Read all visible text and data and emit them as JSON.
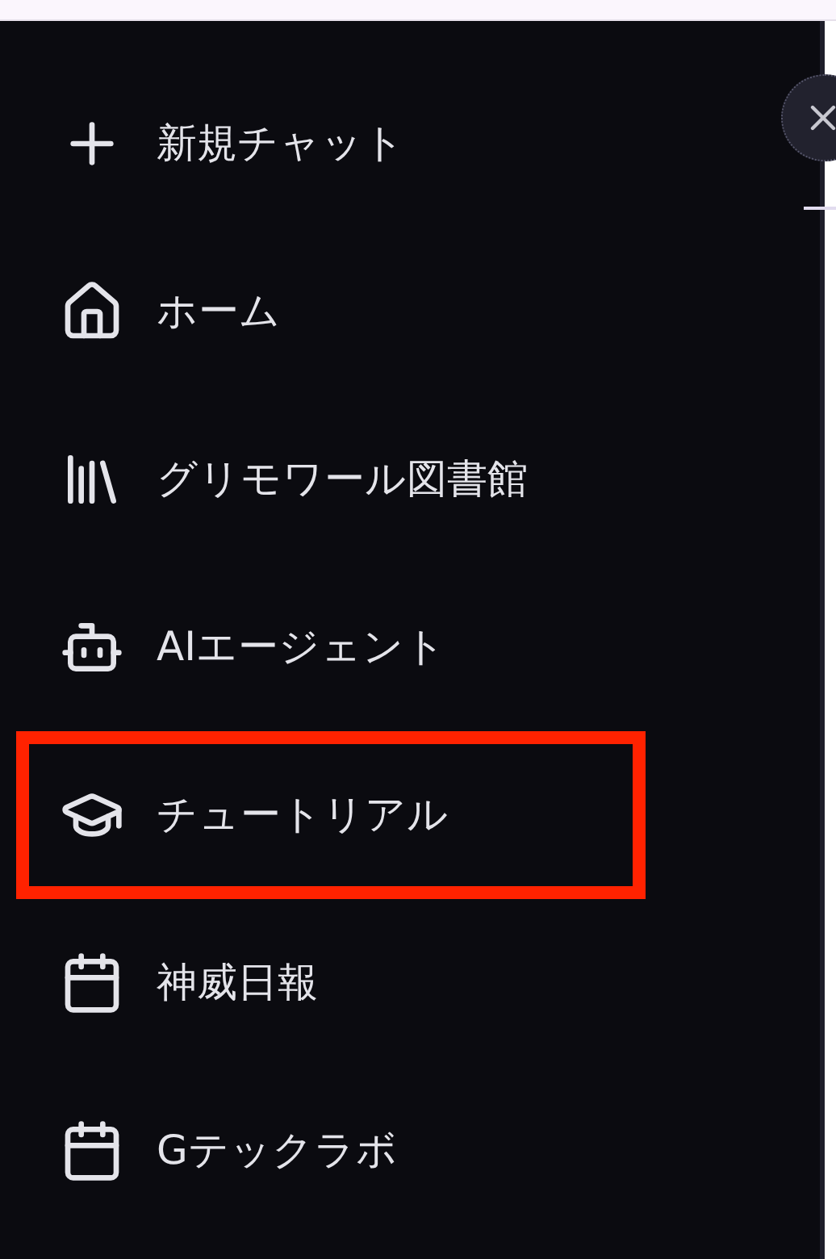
{
  "sidebar": {
    "items": [
      {
        "kind": "plus",
        "label": "新規チャット",
        "highlighted": false
      },
      {
        "kind": "home",
        "label": "ホーム",
        "highlighted": false
      },
      {
        "kind": "library",
        "label": "グリモワール図書館",
        "highlighted": false
      },
      {
        "kind": "bot",
        "label": "AIエージェント",
        "highlighted": false
      },
      {
        "kind": "cap",
        "label": "チュートリアル",
        "highlighted": true
      },
      {
        "kind": "calendar",
        "label": "神威日報",
        "highlighted": false
      },
      {
        "kind": "calendar",
        "label": "Gテックラボ",
        "highlighted": false
      }
    ]
  }
}
